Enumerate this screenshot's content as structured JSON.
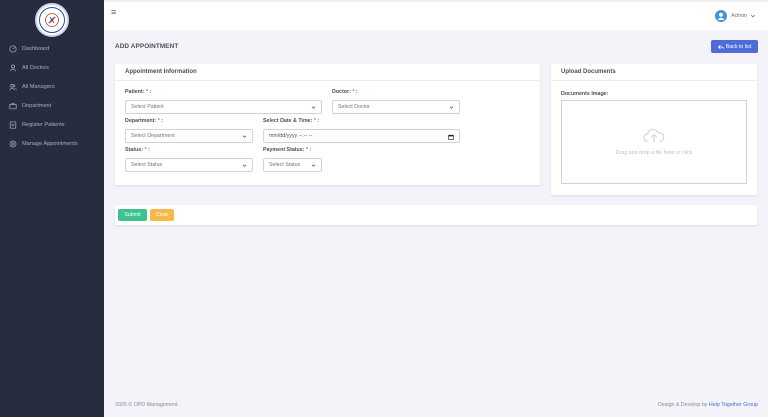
{
  "sidebar": {
    "items": [
      {
        "label": "Dashboard",
        "icon": "dashboard-icon"
      },
      {
        "label": "All Doctors",
        "icon": "user-icon"
      },
      {
        "label": "All Managers",
        "icon": "users-icon"
      },
      {
        "label": "Department",
        "icon": "briefcase-icon"
      },
      {
        "label": "Register Patients",
        "icon": "register-icon"
      },
      {
        "label": "Manage Appointments",
        "icon": "settings-icon"
      }
    ]
  },
  "header": {
    "user_label": "Admin"
  },
  "page": {
    "title": "ADD APPOINTMENT",
    "back_label": "Back to list"
  },
  "appointment_card": {
    "title": "Appointment Information",
    "patient": {
      "label": "Patient:",
      "value": "Select Patient"
    },
    "doctor": {
      "label": "Doctor:",
      "value": "Select Doctor"
    },
    "department": {
      "label": "Department:",
      "value": "Select Department"
    },
    "datetime": {
      "label": "Select Date & Time:",
      "value": "mm/dd/yyyy --:-- --"
    },
    "status": {
      "label": "Status:",
      "value": "Select Status"
    },
    "payment_status": {
      "label": "Payment Status:",
      "value": "Select Status"
    },
    "required_mark": "*",
    "colon": ":"
  },
  "upload_card": {
    "title": "Upload Documents",
    "label": "Documents Image:",
    "dropzone_text": "Drag and drop a file here or click"
  },
  "actions": {
    "submit_label": "Submit",
    "clear_label": "Clear"
  },
  "footer": {
    "copyright": "2025 © OPD Management.",
    "credit_prefix": "Design & Develop by",
    "credit_brand": "Help Together Group"
  },
  "colors": {
    "sidebar": "#252a3d",
    "primary": "#4f6bd8",
    "submit": "#3ec38e",
    "clear": "#f7b84b",
    "required": "#f06548"
  }
}
